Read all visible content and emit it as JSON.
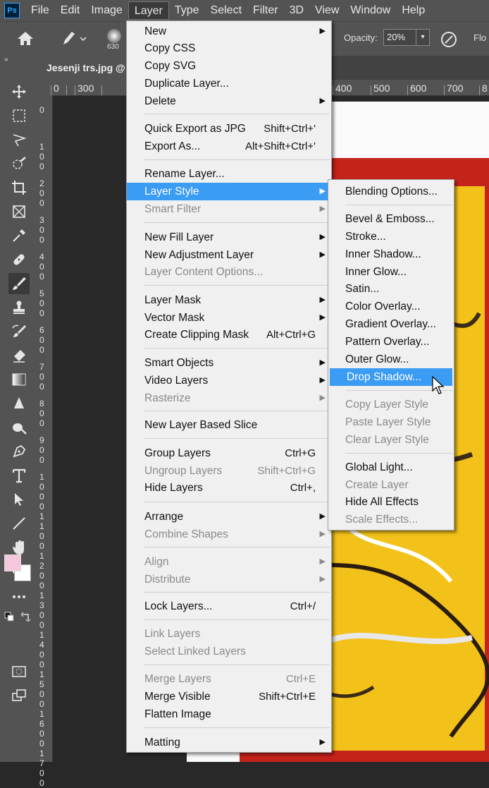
{
  "app": {
    "logo": "Ps"
  },
  "menubar": {
    "items": [
      "File",
      "Edit",
      "Image",
      "Layer",
      "Type",
      "Select",
      "Filter",
      "3D",
      "View",
      "Window",
      "Help"
    ],
    "active": "Layer"
  },
  "options_bar": {
    "brush_size": "630",
    "opacity_label": "Opacity:",
    "opacity_value": "20%",
    "flow_label": "Flo"
  },
  "panel_toggle": "»",
  "document_tab": {
    "title": "Jesenji trs.jpg @"
  },
  "ruler": {
    "top_labels": [
      "0",
      "300",
      "400",
      "500",
      "600",
      "700",
      "8"
    ],
    "left_labels": [
      "0",
      "100",
      "200",
      "300",
      "400",
      "500",
      "600",
      "700",
      "800",
      "900",
      "1000",
      "1100",
      "1200",
      "1300",
      "1400",
      "1500",
      "1600",
      "1700"
    ]
  },
  "layer_menu": {
    "items": [
      {
        "label": "New",
        "submenu": true
      },
      {
        "label": "Copy CSS"
      },
      {
        "label": "Copy SVG"
      },
      {
        "label": "Duplicate Layer..."
      },
      {
        "label": "Delete",
        "submenu": true
      },
      {
        "label": "Quick Export as JPG",
        "shortcut": "Shift+Ctrl+'"
      },
      {
        "label": "Export As...",
        "shortcut": "Alt+Shift+Ctrl+'"
      },
      {
        "label": "Rename Layer..."
      },
      {
        "label": "Layer Style",
        "submenu": true,
        "highlighted": true
      },
      {
        "label": "Smart Filter",
        "submenu": true,
        "disabled": true
      },
      {
        "label": "New Fill Layer",
        "submenu": true
      },
      {
        "label": "New Adjustment Layer",
        "submenu": true
      },
      {
        "label": "Layer Content Options...",
        "disabled": true
      },
      {
        "label": "Layer Mask",
        "submenu": true
      },
      {
        "label": "Vector Mask",
        "submenu": true
      },
      {
        "label": "Create Clipping Mask",
        "shortcut": "Alt+Ctrl+G"
      },
      {
        "label": "Smart Objects",
        "submenu": true
      },
      {
        "label": "Video Layers",
        "submenu": true
      },
      {
        "label": "Rasterize",
        "submenu": true,
        "disabled": true
      },
      {
        "label": "New Layer Based Slice"
      },
      {
        "label": "Group Layers",
        "shortcut": "Ctrl+G"
      },
      {
        "label": "Ungroup Layers",
        "shortcut": "Shift+Ctrl+G",
        "disabled": true
      },
      {
        "label": "Hide Layers",
        "shortcut": "Ctrl+,"
      },
      {
        "label": "Arrange",
        "submenu": true
      },
      {
        "label": "Combine Shapes",
        "submenu": true,
        "disabled": true
      },
      {
        "label": "Align",
        "submenu": true,
        "disabled": true
      },
      {
        "label": "Distribute",
        "submenu": true,
        "disabled": true
      },
      {
        "label": "Lock Layers...",
        "shortcut": "Ctrl+/"
      },
      {
        "label": "Link Layers",
        "disabled": true
      },
      {
        "label": "Select Linked Layers",
        "disabled": true
      },
      {
        "label": "Merge Layers",
        "shortcut": "Ctrl+E",
        "disabled": true
      },
      {
        "label": "Merge Visible",
        "shortcut": "Shift+Ctrl+E"
      },
      {
        "label": "Flatten Image"
      },
      {
        "label": "Matting",
        "submenu": true
      }
    ]
  },
  "layer_style_menu": {
    "items": [
      {
        "label": "Blending Options..."
      },
      {
        "label": "Bevel & Emboss..."
      },
      {
        "label": "Stroke..."
      },
      {
        "label": "Inner Shadow..."
      },
      {
        "label": "Inner Glow..."
      },
      {
        "label": "Satin..."
      },
      {
        "label": "Color Overlay..."
      },
      {
        "label": "Gradient Overlay..."
      },
      {
        "label": "Pattern Overlay..."
      },
      {
        "label": "Outer Glow..."
      },
      {
        "label": "Drop Shadow...",
        "highlighted": true
      },
      {
        "label": "Copy Layer Style",
        "disabled": true
      },
      {
        "label": "Paste Layer Style",
        "disabled": true
      },
      {
        "label": "Clear Layer Style",
        "disabled": true
      },
      {
        "label": "Global Light..."
      },
      {
        "label": "Create Layer",
        "disabled": true
      },
      {
        "label": "Hide All Effects"
      },
      {
        "label": "Scale Effects...",
        "disabled": true
      }
    ]
  },
  "colors": {
    "menu_highlight": "#3b9cf3",
    "foreground": "#f5c7dc",
    "background": "#ffffff",
    "painting_red": "#c4231b",
    "painting_yellow": "#f2c21a"
  }
}
